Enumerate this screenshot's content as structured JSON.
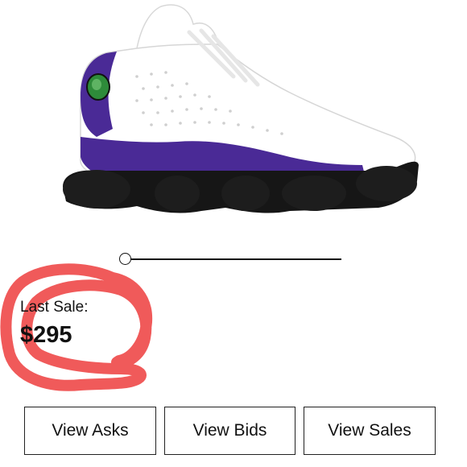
{
  "product": {
    "image_icon": "sneaker-image",
    "colors": {
      "upper": "#ffffff",
      "accent": "#4a2a96",
      "sole": "#1a1a1a",
      "eyelet": "#2e8b3a"
    }
  },
  "slider": {
    "position_fraction": 0.0
  },
  "last_sale": {
    "label": "Last Sale:",
    "price": "$295"
  },
  "annotation": {
    "color": "#f05a5a"
  },
  "buttons": {
    "asks_label": "View Asks",
    "bids_label": "View Bids",
    "sales_label": "View Sales"
  }
}
